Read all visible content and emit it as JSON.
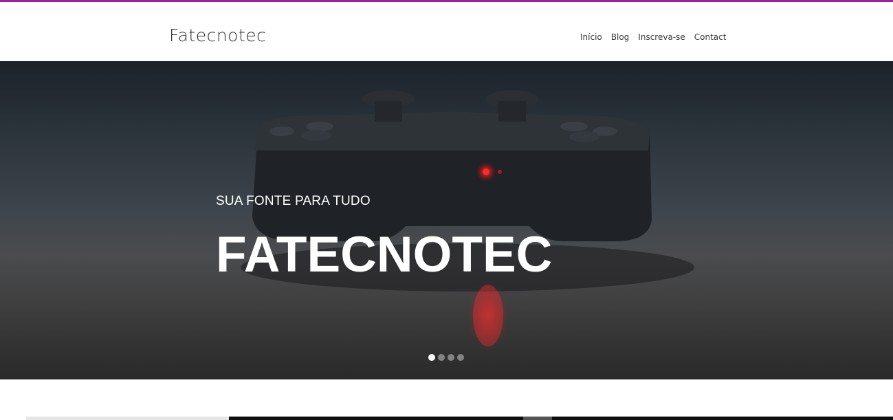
{
  "header": {
    "logo": "Fatecnotec",
    "nav": [
      "Início",
      "Blog",
      "Inscreva-se",
      "Contact"
    ]
  },
  "hero": {
    "subtitle": "SUA FONTE PARA TUDO",
    "title": "FATECNOTEC",
    "slides_total": 4,
    "active_slide": 1
  },
  "colors": {
    "accent": "#9b1fa8",
    "text": "#2e2e2e",
    "hero_text": "#ffffff"
  }
}
